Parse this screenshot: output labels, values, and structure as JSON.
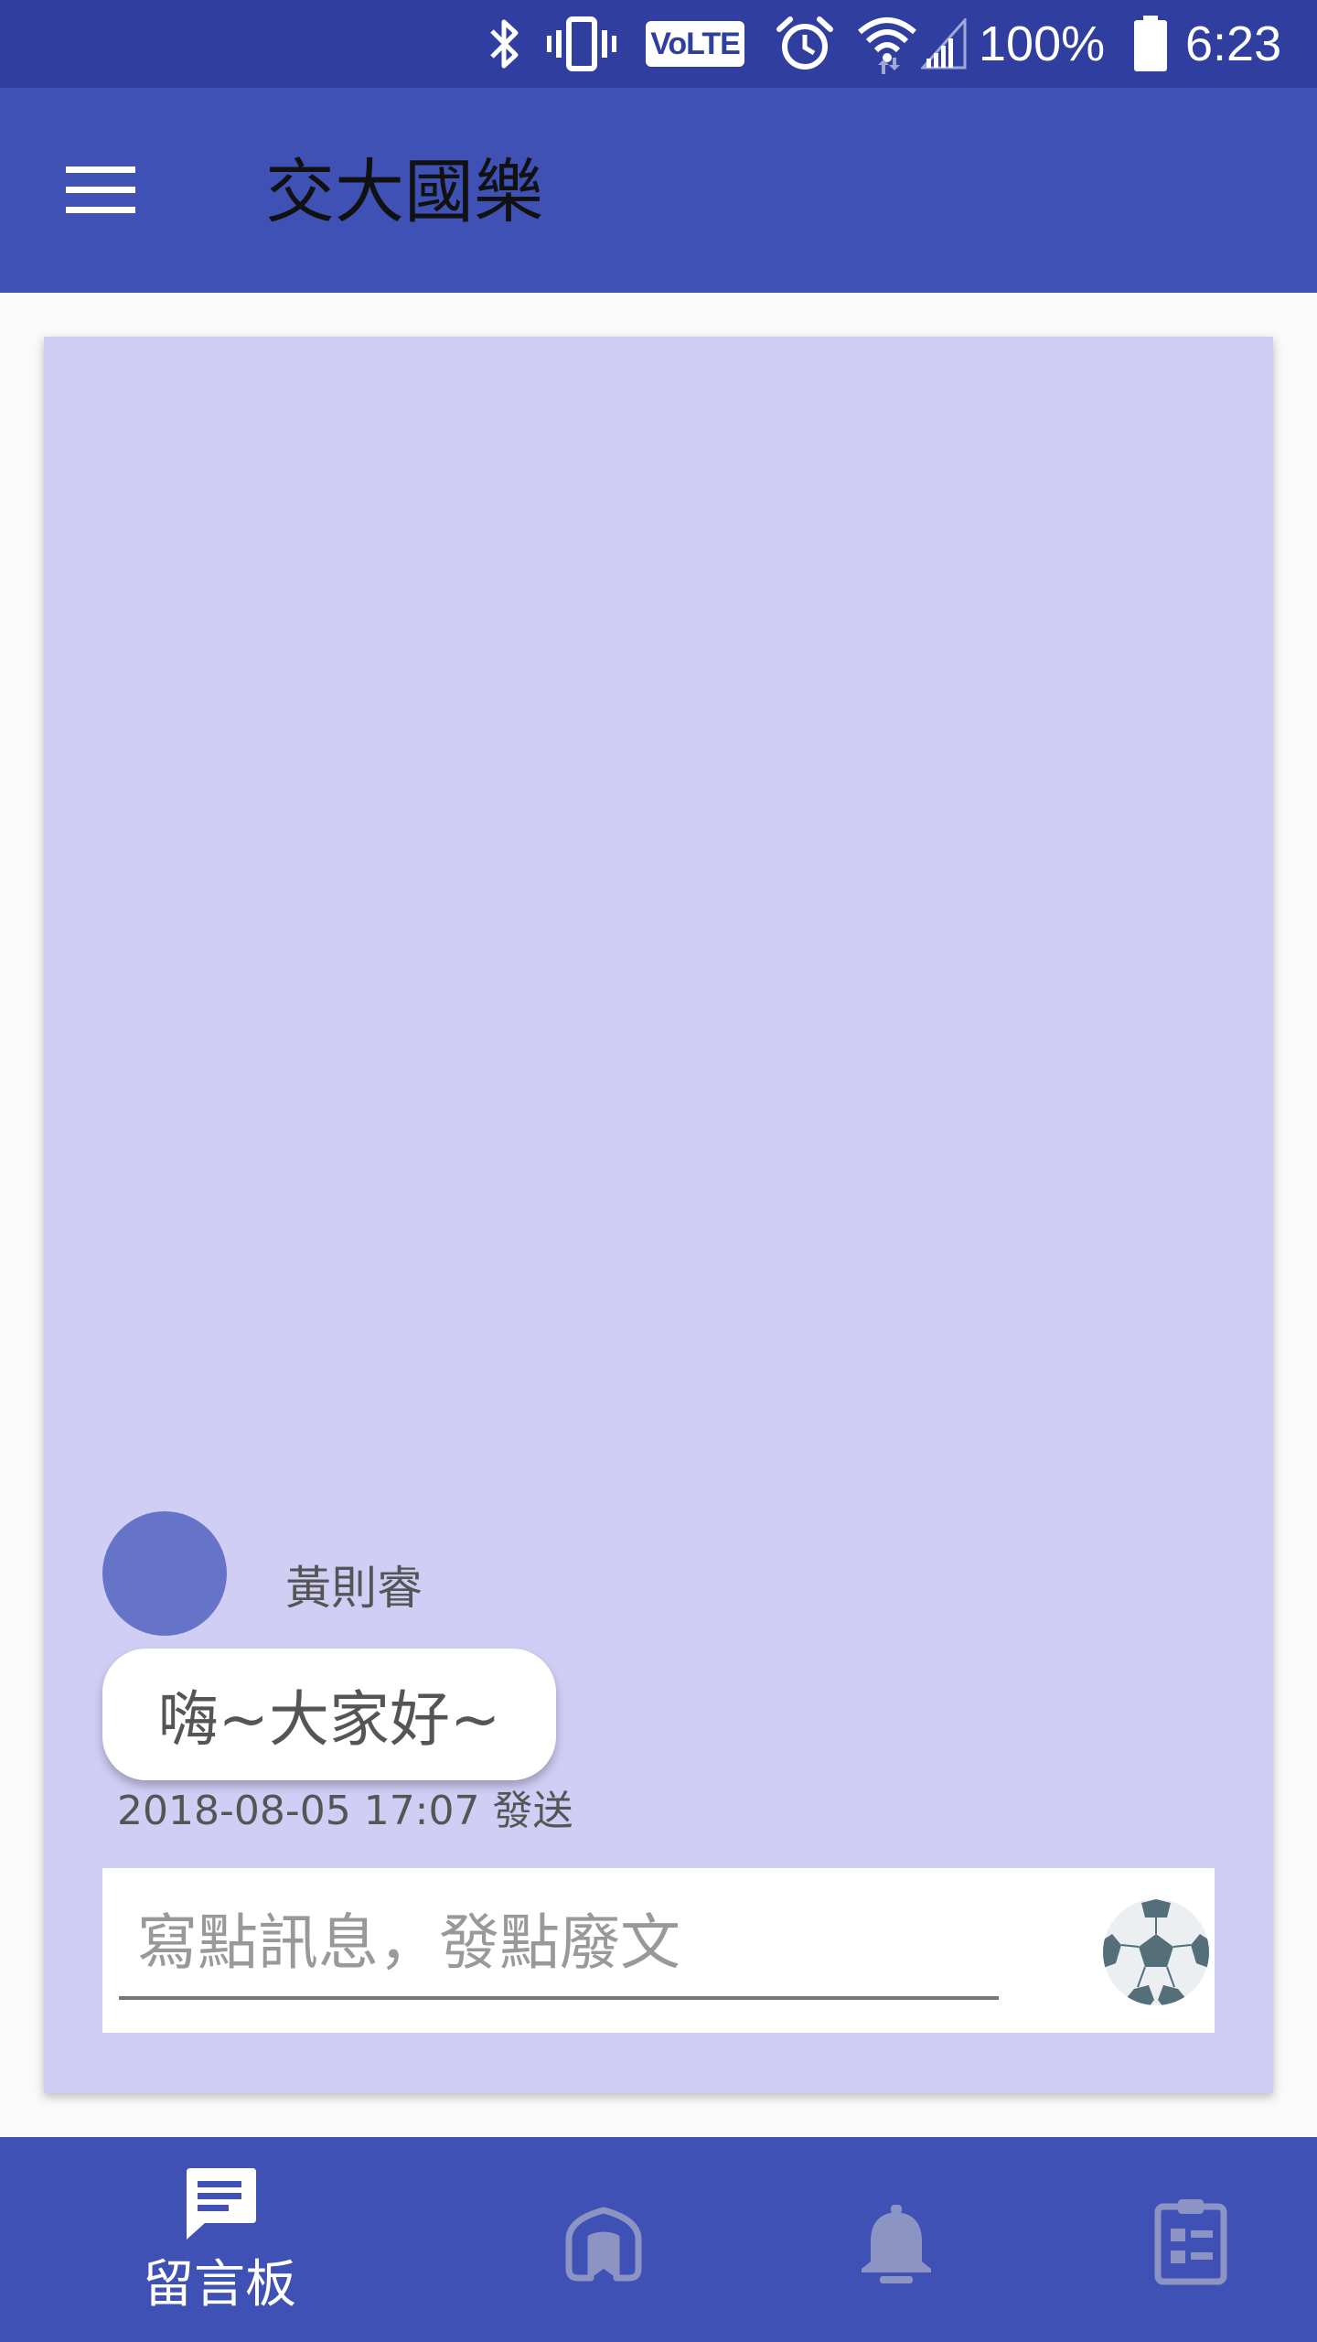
{
  "status_bar": {
    "battery": "100%",
    "time": "6:23",
    "volte_label": "VoLTE",
    "icons": [
      "bluetooth-icon",
      "vibrate-icon",
      "volte-icon",
      "alarm-icon",
      "wifi-icon",
      "signal-icon",
      "battery-icon"
    ]
  },
  "app_bar": {
    "title": "交大國樂",
    "menu_icon": "menu-icon"
  },
  "messages": [
    {
      "sender": "黃則睿",
      "text": "嗨~大家好~",
      "timestamp": "2018-08-05 17:07 發送"
    }
  ],
  "composer": {
    "placeholder": "寫點訊息，發點廢文",
    "value": "",
    "send_icon": "soccer-ball-icon"
  },
  "bottom_nav": {
    "items": [
      {
        "label": "留言板",
        "icon": "message-board-icon",
        "active": true
      },
      {
        "label": "",
        "icon": "book-icon",
        "active": false
      },
      {
        "label": "",
        "icon": "bell-icon",
        "active": false
      },
      {
        "label": "",
        "icon": "clipboard-icon",
        "active": false
      }
    ]
  },
  "colors": {
    "primary_dark": "#303F9F",
    "primary": "#3F51B5",
    "board_background": "#D0CEF5",
    "avatar": "#6574C8",
    "inactive_icon": "#8C94C4"
  }
}
